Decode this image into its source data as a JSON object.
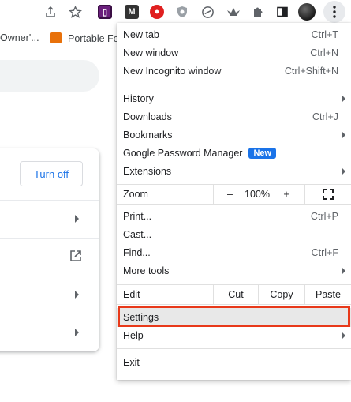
{
  "toolbar": {
    "icons": [
      "share-icon",
      "star-icon",
      "extension-purple-icon",
      "extension-m-icon",
      "extension-red-icon",
      "extension-shield-icon",
      "extension-circle-icon",
      "extension-bird-icon",
      "extensions-puzzle-icon",
      "side-panel-icon",
      "profile-avatar",
      "menu-kebab-icon"
    ]
  },
  "bookmarks": {
    "item1": "Owner'...",
    "item2": "Portable Fo"
  },
  "page": {
    "turn_off": "Turn off"
  },
  "menu": {
    "new_tab": {
      "label": "New tab",
      "shortcut": "Ctrl+T"
    },
    "new_window": {
      "label": "New window",
      "shortcut": "Ctrl+N"
    },
    "new_incognito": {
      "label": "New Incognito window",
      "shortcut": "Ctrl+Shift+N"
    },
    "history": {
      "label": "History"
    },
    "downloads": {
      "label": "Downloads",
      "shortcut": "Ctrl+J"
    },
    "bookmarks": {
      "label": "Bookmarks"
    },
    "password_manager": {
      "label": "Google Password Manager",
      "badge": "New"
    },
    "extensions": {
      "label": "Extensions"
    },
    "zoom": {
      "label": "Zoom",
      "minus": "–",
      "value": "100%",
      "plus": "+"
    },
    "print": {
      "label": "Print...",
      "shortcut": "Ctrl+P"
    },
    "cast": {
      "label": "Cast..."
    },
    "find": {
      "label": "Find...",
      "shortcut": "Ctrl+F"
    },
    "more_tools": {
      "label": "More tools"
    },
    "edit": {
      "label": "Edit",
      "cut": "Cut",
      "copy": "Copy",
      "paste": "Paste"
    },
    "settings": {
      "label": "Settings"
    },
    "help": {
      "label": "Help"
    },
    "exit": {
      "label": "Exit"
    }
  },
  "colors": {
    "accent": "#1a73e8",
    "highlight_box": "#e8391a"
  }
}
